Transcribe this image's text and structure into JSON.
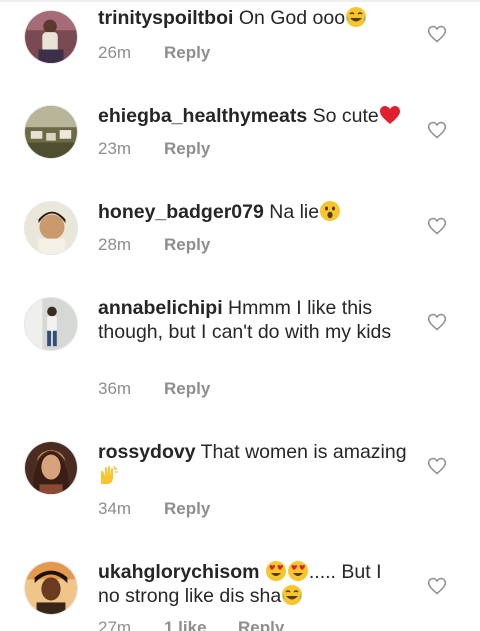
{
  "comments": [
    {
      "username": "trinityspoiltboi",
      "text": "On God ooo",
      "emoji": "laugh-crying-emoji",
      "time": "26m",
      "reply_label": "Reply"
    },
    {
      "username": "ehiegba_healthymeats",
      "text": "So cute",
      "emoji": "red-heart-emoji",
      "time": "23m",
      "reply_label": "Reply"
    },
    {
      "username": "honey_badger079",
      "text": "Na lie",
      "emoji": "astonished-face-emoji",
      "time": "28m",
      "reply_label": "Reply"
    },
    {
      "username": "annabelichipi",
      "text": "Hmmm I like this though, but I can't do with my kids",
      "time": "36m",
      "reply_label": "Reply"
    },
    {
      "username": "rossydovy",
      "text": "That women is amazing",
      "emoji": "raising-hands-emoji",
      "time": "34m",
      "reply_label": "Reply"
    },
    {
      "username": "ukahglorychisom",
      "text_before": "",
      "emoji_lead": [
        "heart-eyes-emoji",
        "heart-eyes-emoji"
      ],
      "text": "..... But I no strong like dis sha",
      "emoji": "laugh-crying-emoji",
      "time": "27m",
      "likes": "1 like",
      "reply_label": "Reply"
    }
  ],
  "colors": {
    "text": "#262626",
    "meta": "#8e8e8e",
    "heart_outline": "#8e8e8e"
  },
  "icons": {
    "like": "heart-outline-icon"
  }
}
